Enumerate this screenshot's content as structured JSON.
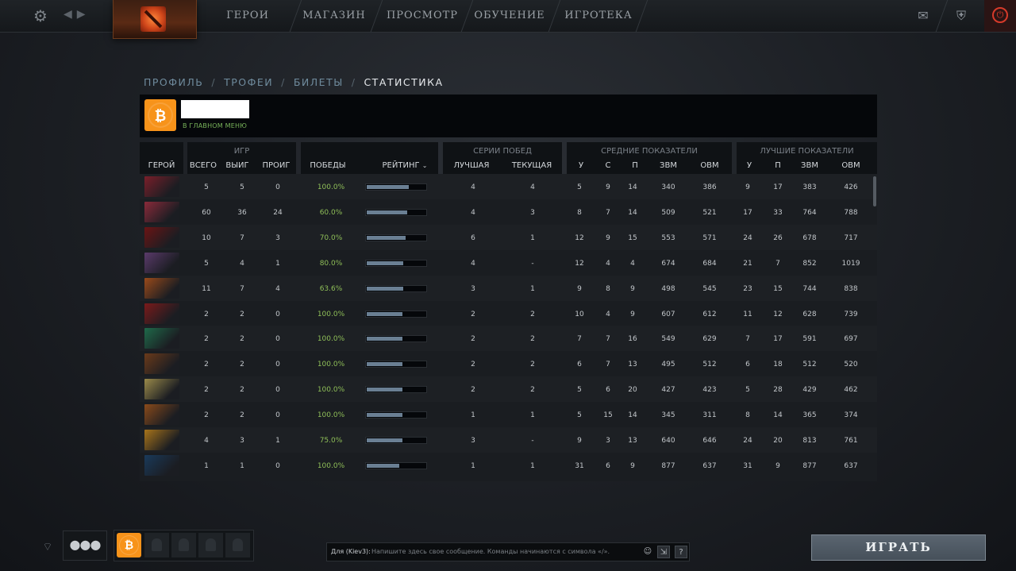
{
  "topbar": {
    "nav": [
      "ГЕРОИ",
      "МАГАЗИН",
      "ПРОСМОТР",
      "ОБУЧЕНИЕ",
      "ИГРОТЕКА"
    ],
    "icons": [
      "gear-icon",
      "back-arrow-icon",
      "forward-arrow-icon",
      "mail-icon",
      "armory-icon",
      "power-icon"
    ]
  },
  "breadcrumb": [
    "ПРОФИЛЬ",
    "ТРОФЕИ",
    "БИЛЕТЫ",
    "СТАТИСТИКА"
  ],
  "breadcrumb_sep": "/",
  "profile": {
    "status": "В ГЛАВНОМ МЕНЮ",
    "avatar_icon": "bitcoin-icon"
  },
  "table": {
    "hero_header": "ГЕРОЙ",
    "games": {
      "title": "ИГР",
      "total": "ВСЕГО",
      "wins": "ВЫИГ",
      "losses": "ПРОИГ"
    },
    "winrate": {
      "wins": "ПОБЕДЫ",
      "rating": "РЕЙТИНГ",
      "sort_icon": "chevron-down-icon"
    },
    "streaks": {
      "title": "СЕРИИ ПОБЕД",
      "best": "ЛУЧШАЯ",
      "current": "ТЕКУЩАЯ"
    },
    "averages": {
      "title": "СРЕДНИЕ ПОКАЗАТЕЛИ",
      "k": "У",
      "d": "С",
      "a": "П",
      "gpm": "ЗВМ",
      "xpm": "ОВМ"
    },
    "bests": {
      "title": "ЛУЧШИЕ ПОКАЗАТЕЛИ",
      "k": "У",
      "a": "П",
      "gpm": "ЗВМ",
      "xpm": "ОВМ"
    },
    "rows": [
      {
        "total": "5",
        "wins": "5",
        "losses": "0",
        "winrate": "100.0%",
        "rating": 0.7,
        "best_streak": "4",
        "cur_streak": "4",
        "avg_k": "5",
        "avg_d": "9",
        "avg_a": "14",
        "avg_gpm": "340",
        "avg_xpm": "386",
        "best_k": "9",
        "best_a": "17",
        "best_gpm": "383",
        "best_xpm": "426",
        "hero_color": "#7a1f2a"
      },
      {
        "total": "60",
        "wins": "36",
        "losses": "24",
        "winrate": "60.0%",
        "rating": 0.67,
        "best_streak": "4",
        "cur_streak": "3",
        "avg_k": "8",
        "avg_d": "7",
        "avg_a": "14",
        "avg_gpm": "509",
        "avg_xpm": "521",
        "best_k": "17",
        "best_a": "33",
        "best_gpm": "764",
        "best_xpm": "788",
        "hero_color": "#8a2a3a"
      },
      {
        "total": "10",
        "wins": "7",
        "losses": "3",
        "winrate": "70.0%",
        "rating": 0.64,
        "best_streak": "6",
        "cur_streak": "1",
        "avg_k": "12",
        "avg_d": "9",
        "avg_a": "15",
        "avg_gpm": "553",
        "avg_xpm": "571",
        "best_k": "24",
        "best_a": "26",
        "best_gpm": "678",
        "best_xpm": "717",
        "hero_color": "#6a1414"
      },
      {
        "total": "5",
        "wins": "4",
        "losses": "1",
        "winrate": "80.0%",
        "rating": 0.61,
        "best_streak": "4",
        "cur_streak": "-",
        "avg_k": "12",
        "avg_d": "4",
        "avg_a": "4",
        "avg_gpm": "674",
        "avg_xpm": "684",
        "best_k": "21",
        "best_a": "7",
        "best_gpm": "852",
        "best_xpm": "1019",
        "hero_color": "#5a3a6a"
      },
      {
        "total": "11",
        "wins": "7",
        "losses": "4",
        "winrate": "63.6%",
        "rating": 0.6,
        "best_streak": "3",
        "cur_streak": "1",
        "avg_k": "9",
        "avg_d": "8",
        "avg_a": "9",
        "avg_gpm": "498",
        "avg_xpm": "545",
        "best_k": "23",
        "best_a": "15",
        "best_gpm": "744",
        "best_xpm": "838",
        "hero_color": "#9a4a1a"
      },
      {
        "total": "2",
        "wins": "2",
        "losses": "0",
        "winrate": "100.0%",
        "rating": 0.59,
        "best_streak": "2",
        "cur_streak": "2",
        "avg_k": "10",
        "avg_d": "4",
        "avg_a": "9",
        "avg_gpm": "607",
        "avg_xpm": "612",
        "best_k": "11",
        "best_a": "12",
        "best_gpm": "628",
        "best_xpm": "739",
        "hero_color": "#7a1a1a"
      },
      {
        "total": "2",
        "wins": "2",
        "losses": "0",
        "winrate": "100.0%",
        "rating": 0.59,
        "best_streak": "2",
        "cur_streak": "2",
        "avg_k": "7",
        "avg_d": "7",
        "avg_a": "16",
        "avg_gpm": "549",
        "avg_xpm": "629",
        "best_k": "7",
        "best_a": "17",
        "best_gpm": "591",
        "best_xpm": "697",
        "hero_color": "#1f6a4a"
      },
      {
        "total": "2",
        "wins": "2",
        "losses": "0",
        "winrate": "100.0%",
        "rating": 0.59,
        "best_streak": "2",
        "cur_streak": "2",
        "avg_k": "6",
        "avg_d": "7",
        "avg_a": "13",
        "avg_gpm": "495",
        "avg_xpm": "512",
        "best_k": "6",
        "best_a": "18",
        "best_gpm": "512",
        "best_xpm": "520",
        "hero_color": "#6a3a1a"
      },
      {
        "total": "2",
        "wins": "2",
        "losses": "0",
        "winrate": "100.0%",
        "rating": 0.59,
        "best_streak": "2",
        "cur_streak": "2",
        "avg_k": "5",
        "avg_d": "6",
        "avg_a": "20",
        "avg_gpm": "427",
        "avg_xpm": "423",
        "best_k": "5",
        "best_a": "28",
        "best_gpm": "429",
        "best_xpm": "462",
        "hero_color": "#9a8a4a"
      },
      {
        "total": "2",
        "wins": "2",
        "losses": "0",
        "winrate": "100.0%",
        "rating": 0.59,
        "best_streak": "1",
        "cur_streak": "1",
        "avg_k": "5",
        "avg_d": "15",
        "avg_a": "14",
        "avg_gpm": "345",
        "avg_xpm": "311",
        "best_k": "8",
        "best_a": "14",
        "best_gpm": "365",
        "best_xpm": "374",
        "hero_color": "#8a4a1a"
      },
      {
        "total": "4",
        "wins": "3",
        "losses": "1",
        "winrate": "75.0%",
        "rating": 0.59,
        "best_streak": "3",
        "cur_streak": "-",
        "avg_k": "9",
        "avg_d": "3",
        "avg_a": "13",
        "avg_gpm": "640",
        "avg_xpm": "646",
        "best_k": "24",
        "best_a": "20",
        "best_gpm": "813",
        "best_xpm": "761",
        "hero_color": "#a8741a"
      },
      {
        "total": "1",
        "wins": "1",
        "losses": "0",
        "winrate": "100.0%",
        "rating": 0.54,
        "best_streak": "1",
        "cur_streak": "1",
        "avg_k": "31",
        "avg_d": "6",
        "avg_a": "9",
        "avg_gpm": "877",
        "avg_xpm": "637",
        "best_k": "31",
        "best_a": "9",
        "best_gpm": "877",
        "best_xpm": "637",
        "hero_color": "#1a3a5a"
      }
    ]
  },
  "bottom": {
    "chat_label": "Для (Kiev3):",
    "chat_placeholder": "Напишите здесь свое сообщение. Команды начинаются с символа «/».",
    "help": "?",
    "play": "ИГРАТЬ"
  }
}
